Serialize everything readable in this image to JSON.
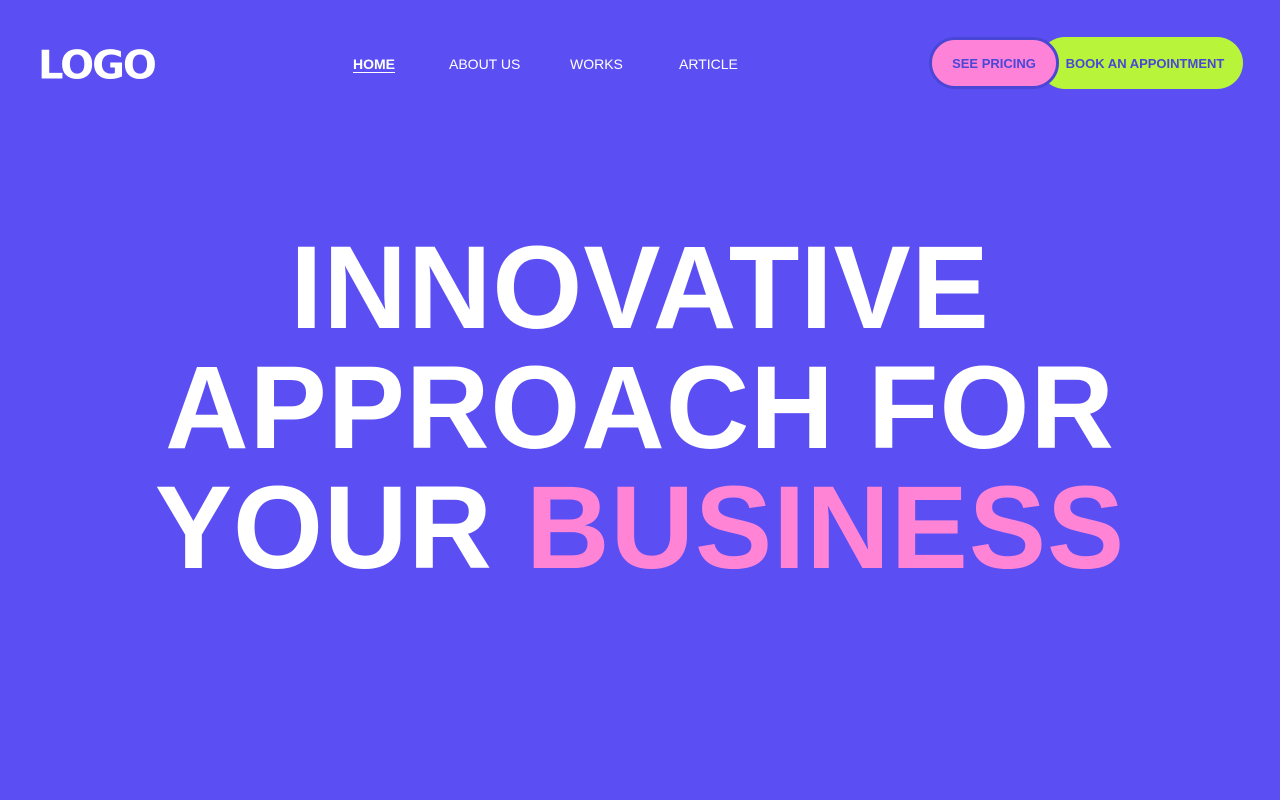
{
  "brand": {
    "logo_text": "LOGO"
  },
  "nav": {
    "items": [
      {
        "label": "HOME",
        "active": true
      },
      {
        "label": "ABOUT US",
        "active": false
      },
      {
        "label": "WORKS",
        "active": false
      },
      {
        "label": "ARTICLE",
        "active": false
      }
    ]
  },
  "actions": {
    "pricing_label": "SEE PRICING",
    "appointment_label": "BOOK AN APPOINTMENT"
  },
  "hero": {
    "line1": "INNOVATIVE",
    "line2": "APPROACH FOR",
    "line3_prefix": "YOUR",
    "line3_accent": "BUSINESS"
  },
  "colors": {
    "background": "#5b4ff3",
    "accent_pink": "#ff84d6",
    "accent_lime": "#b8f53a",
    "text_white": "#ffffff",
    "button_text": "#4a46d6"
  }
}
